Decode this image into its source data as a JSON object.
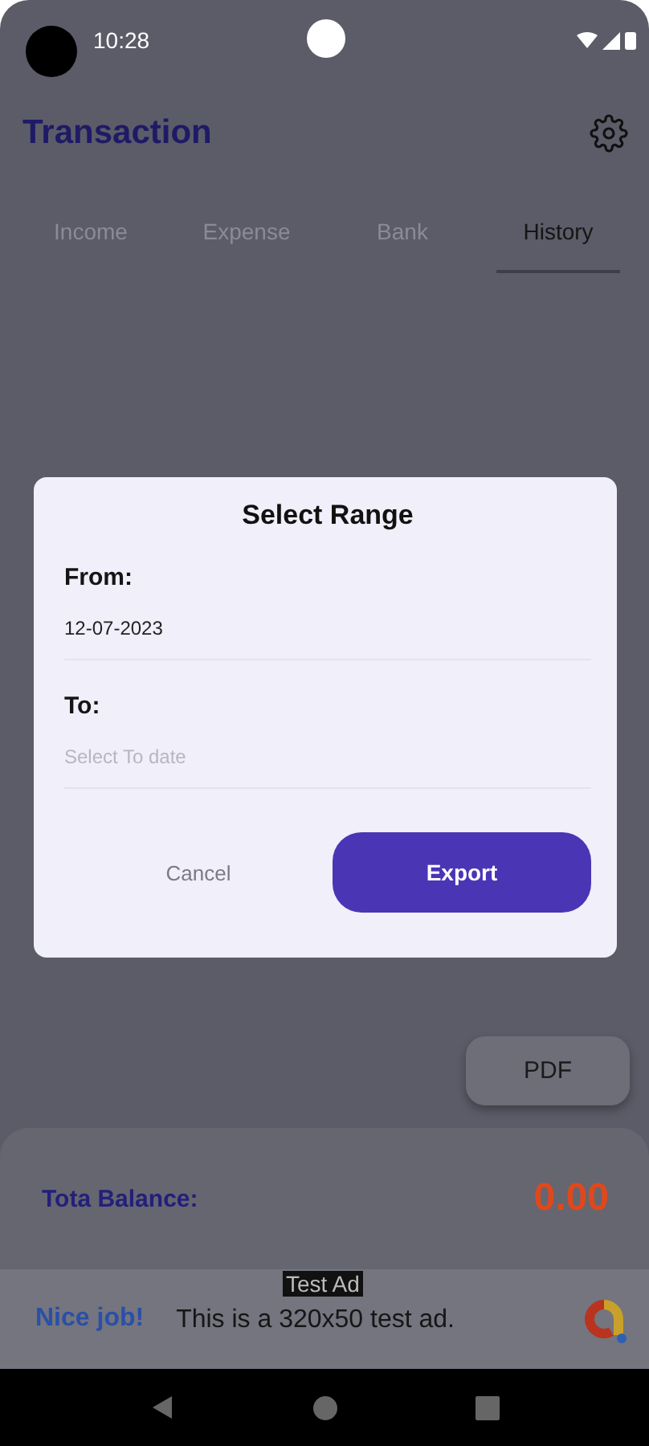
{
  "status_bar": {
    "time": "10:28"
  },
  "header": {
    "title": "Transaction"
  },
  "tabs": [
    {
      "label": "Income",
      "selected": false
    },
    {
      "label": "Expense",
      "selected": false
    },
    {
      "label": "Bank",
      "selected": false
    },
    {
      "label": "History",
      "selected": true
    }
  ],
  "pdf_button": "PDF",
  "balance": {
    "label": "Tota Balance:",
    "amount": "0.00"
  },
  "ad": {
    "badge": "Test Ad",
    "headline": "Nice job!",
    "text": "This is a 320x50 test ad."
  },
  "dialog": {
    "title": "Select Range",
    "fields": [
      {
        "label": "From:",
        "value": "12-07-2023"
      },
      {
        "label": "To:",
        "placeholder": "Select To date"
      }
    ],
    "buttons": [
      {
        "label": "Cancel",
        "kind": "text"
      },
      {
        "label": "Export",
        "kind": "primary"
      }
    ]
  }
}
